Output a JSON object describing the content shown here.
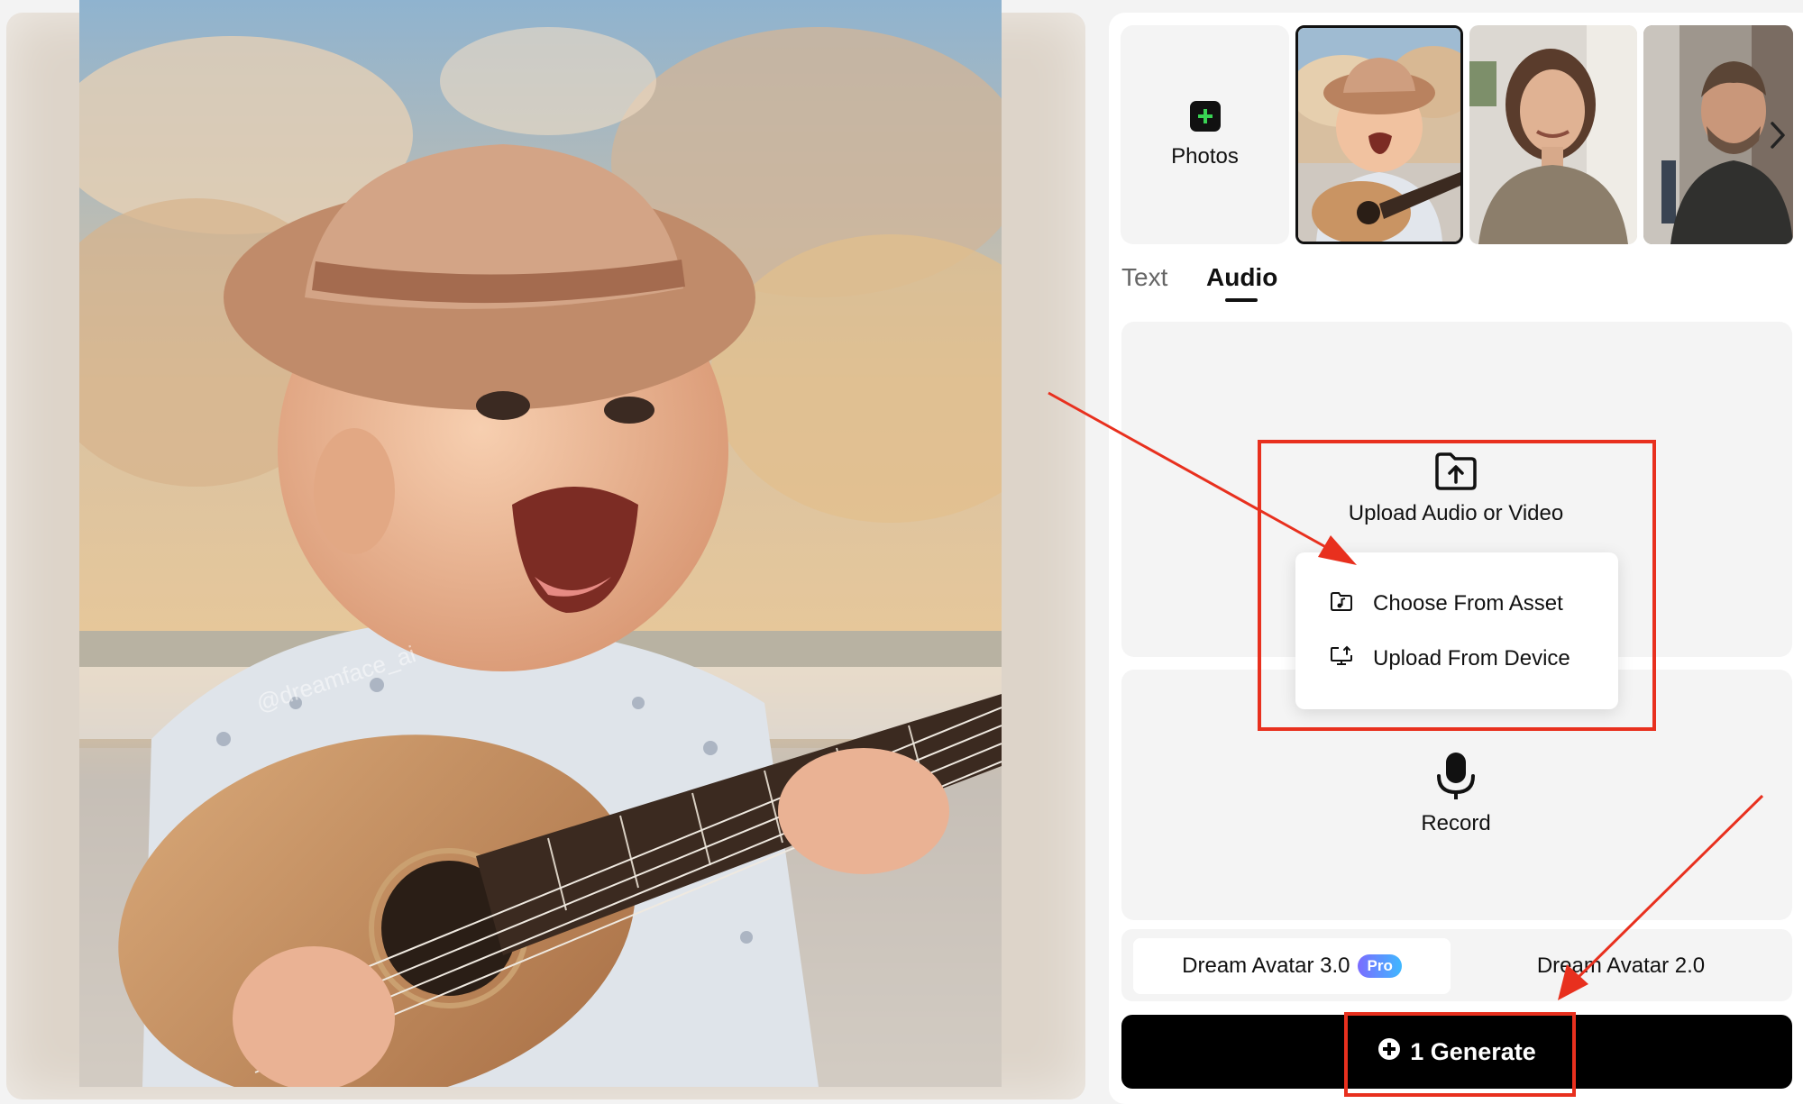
{
  "preview": {
    "image": "baby-with-straw-hat-playing-ukulele-on-beach",
    "watermark": "@dreamface_ai"
  },
  "photos": {
    "add_label": "Photos",
    "add_icon": "plus-icon",
    "accent_color": "#39d353",
    "thumbnails": [
      {
        "subject": "baby-with-ukulele",
        "selected": true
      },
      {
        "subject": "smiling-woman",
        "selected": false
      },
      {
        "subject": "man-in-jacket-street",
        "selected": false
      }
    ],
    "next_icon": "chevron-right-icon"
  },
  "tabs": {
    "items": [
      {
        "label": "Text",
        "active": false
      },
      {
        "label": "Audio",
        "active": true
      }
    ]
  },
  "upload": {
    "label": "Upload Audio or Video",
    "icon": "folder-upload-icon",
    "menu": [
      {
        "label": "Choose From Asset",
        "icon": "music-folder-icon"
      },
      {
        "label": "Upload From Device",
        "icon": "monitor-upload-icon"
      }
    ]
  },
  "record": {
    "label": "Record",
    "icon": "microphone-icon"
  },
  "models": {
    "option_1": "Dream Avatar 3.0",
    "option_1_badge": "Pro",
    "option_2": "Dream Avatar 2.0",
    "selected": "Dream Avatar 3.0"
  },
  "generate": {
    "label": "1 Generate",
    "icon": "coin-plus-icon"
  },
  "annotations": {
    "highlight_color": "#e8301e"
  }
}
